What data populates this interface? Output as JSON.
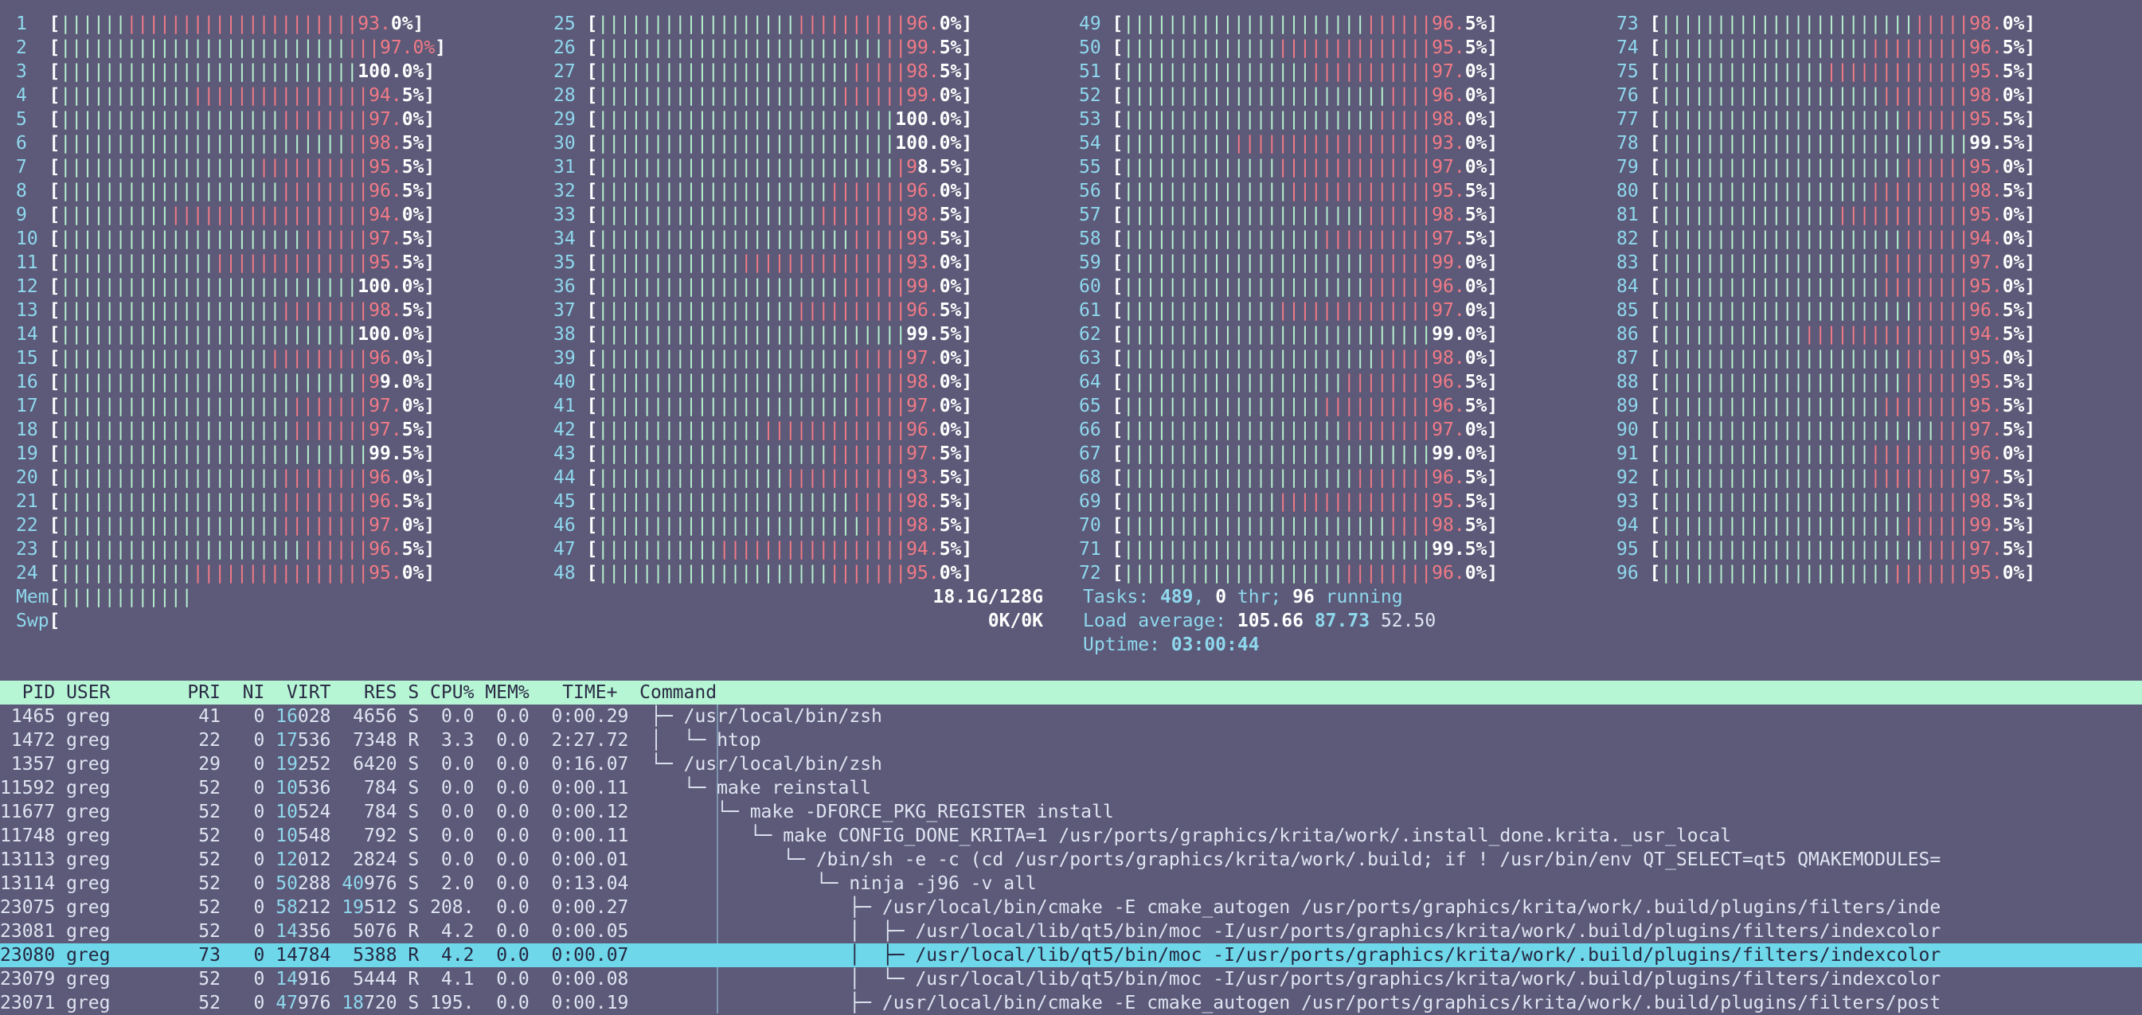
{
  "cpus": [
    {
      "n": "1",
      "pct": "93.",
      "pctw": "0%",
      "g": 6,
      "r": 21
    },
    {
      "n": "2",
      "pct": "97.0%",
      "pctw": "",
      "g": 26,
      "r": 3
    },
    {
      "n": "3",
      "pct": "",
      "pctw": "100.0%",
      "g": 27,
      "r": 0
    },
    {
      "n": "4",
      "pct": "94.",
      "pctw": "5%",
      "g": 12,
      "r": 16
    },
    {
      "n": "5",
      "pct": "97.",
      "pctw": "0%",
      "g": 20,
      "r": 8
    },
    {
      "n": "6",
      "pct": "98.",
      "pctw": "5%",
      "g": 26,
      "r": 2
    },
    {
      "n": "7",
      "pct": "95.",
      "pctw": "5%",
      "g": 18,
      "r": 10
    },
    {
      "n": "8",
      "pct": "96.",
      "pctw": "5%",
      "g": 20,
      "r": 8
    },
    {
      "n": "9",
      "pct": "94.",
      "pctw": "0%",
      "g": 10,
      "r": 18
    },
    {
      "n": "10",
      "pct": "97.",
      "pctw": "5%",
      "g": 22,
      "r": 6
    },
    {
      "n": "11",
      "pct": "95.",
      "pctw": "5%",
      "g": 14,
      "r": 14
    },
    {
      "n": "12",
      "pct": "",
      "pctw": "100.0%",
      "g": 27,
      "r": 0
    },
    {
      "n": "13",
      "pct": "98.",
      "pctw": "5%",
      "g": 20,
      "r": 8
    },
    {
      "n": "14",
      "pct": "",
      "pctw": "100.0%",
      "g": 27,
      "r": 0
    },
    {
      "n": "15",
      "pct": "96.",
      "pctw": "0%",
      "g": 19,
      "r": 9
    },
    {
      "n": "16",
      "pct": "9",
      "pctw": "9.0%",
      "g": 27,
      "r": 1
    },
    {
      "n": "17",
      "pct": "97.",
      "pctw": "0%",
      "g": 21,
      "r": 7
    },
    {
      "n": "18",
      "pct": "97.",
      "pctw": "5%",
      "g": 21,
      "r": 7
    },
    {
      "n": "19",
      "pct": "",
      "pctw": "99.5%",
      "g": 28,
      "r": 0
    },
    {
      "n": "20",
      "pct": "96.",
      "pctw": "0%",
      "g": 20,
      "r": 8
    },
    {
      "n": "21",
      "pct": "96.",
      "pctw": "5%",
      "g": 20,
      "r": 8
    },
    {
      "n": "22",
      "pct": "97.",
      "pctw": "0%",
      "g": 20,
      "r": 8
    },
    {
      "n": "23",
      "pct": "96.",
      "pctw": "5%",
      "g": 22,
      "r": 6
    },
    {
      "n": "24",
      "pct": "95.",
      "pctw": "0%",
      "g": 12,
      "r": 16
    },
    {
      "n": "25",
      "pct": "96.",
      "pctw": "0%",
      "g": 18,
      "r": 10
    },
    {
      "n": "26",
      "pct": "99.",
      "pctw": "5%",
      "g": 26,
      "r": 2
    },
    {
      "n": "27",
      "pct": "98.",
      "pctw": "5%",
      "g": 23,
      "r": 5
    },
    {
      "n": "28",
      "pct": "99.",
      "pctw": "0%",
      "g": 22,
      "r": 6
    },
    {
      "n": "29",
      "pct": "",
      "pctw": "100.0%",
      "g": 27,
      "r": 0
    },
    {
      "n": "30",
      "pct": "",
      "pctw": "100.0%",
      "g": 27,
      "r": 0
    },
    {
      "n": "31",
      "pct": "9",
      "pctw": "8.5%",
      "g": 27,
      "r": 1
    },
    {
      "n": "32",
      "pct": "96.",
      "pctw": "0%",
      "g": 21,
      "r": 7
    },
    {
      "n": "33",
      "pct": "98.",
      "pctw": "5%",
      "g": 20,
      "r": 8
    },
    {
      "n": "34",
      "pct": "99.",
      "pctw": "5%",
      "g": 23,
      "r": 5
    },
    {
      "n": "35",
      "pct": "93.",
      "pctw": "0%",
      "g": 13,
      "r": 15
    },
    {
      "n": "36",
      "pct": "99.",
      "pctw": "0%",
      "g": 22,
      "r": 6
    },
    {
      "n": "37",
      "pct": "96.",
      "pctw": "5%",
      "g": 18,
      "r": 10
    },
    {
      "n": "38",
      "pct": "",
      "pctw": "99.5%",
      "g": 28,
      "r": 0
    },
    {
      "n": "39",
      "pct": "97.",
      "pctw": "0%",
      "g": 23,
      "r": 5
    },
    {
      "n": "40",
      "pct": "98.",
      "pctw": "0%",
      "g": 23,
      "r": 5
    },
    {
      "n": "41",
      "pct": "97.",
      "pctw": "0%",
      "g": 23,
      "r": 5
    },
    {
      "n": "42",
      "pct": "96.",
      "pctw": "0%",
      "g": 15,
      "r": 13
    },
    {
      "n": "43",
      "pct": "97.",
      "pctw": "5%",
      "g": 21,
      "r": 7
    },
    {
      "n": "44",
      "pct": "93.",
      "pctw": "5%",
      "g": 17,
      "r": 11
    },
    {
      "n": "45",
      "pct": "98.",
      "pctw": "5%",
      "g": 23,
      "r": 5
    },
    {
      "n": "46",
      "pct": "98.",
      "pctw": "5%",
      "g": 24,
      "r": 4
    },
    {
      "n": "47",
      "pct": "94.",
      "pctw": "5%",
      "g": 11,
      "r": 17
    },
    {
      "n": "48",
      "pct": "95.",
      "pctw": "0%",
      "g": 21,
      "r": 7
    },
    {
      "n": "49",
      "pct": "96.",
      "pctw": "5%",
      "g": 22,
      "r": 6
    },
    {
      "n": "50",
      "pct": "95.",
      "pctw": "5%",
      "g": 14,
      "r": 14
    },
    {
      "n": "51",
      "pct": "97.",
      "pctw": "0%",
      "g": 17,
      "r": 11
    },
    {
      "n": "52",
      "pct": "96.",
      "pctw": "0%",
      "g": 24,
      "r": 4
    },
    {
      "n": "53",
      "pct": "98.",
      "pctw": "0%",
      "g": 23,
      "r": 5
    },
    {
      "n": "54",
      "pct": "93.",
      "pctw": "0%",
      "g": 10,
      "r": 18
    },
    {
      "n": "55",
      "pct": "97.",
      "pctw": "0%",
      "g": 14,
      "r": 14
    },
    {
      "n": "56",
      "pct": "95.",
      "pctw": "5%",
      "g": 15,
      "r": 13
    },
    {
      "n": "57",
      "pct": "98.",
      "pctw": "5%",
      "g": 22,
      "r": 6
    },
    {
      "n": "58",
      "pct": "97.",
      "pctw": "5%",
      "g": 18,
      "r": 10
    },
    {
      "n": "59",
      "pct": "99.",
      "pctw": "0%",
      "g": 22,
      "r": 6
    },
    {
      "n": "60",
      "pct": "96.",
      "pctw": "0%",
      "g": 22,
      "r": 6
    },
    {
      "n": "61",
      "pct": "97.",
      "pctw": "0%",
      "g": 14,
      "r": 14
    },
    {
      "n": "62",
      "pct": "",
      "pctw": "99.0%",
      "g": 28,
      "r": 0
    },
    {
      "n": "63",
      "pct": "98.",
      "pctw": "0%",
      "g": 23,
      "r": 5
    },
    {
      "n": "64",
      "pct": "96.",
      "pctw": "5%",
      "g": 20,
      "r": 8
    },
    {
      "n": "65",
      "pct": "96.",
      "pctw": "5%",
      "g": 18,
      "r": 10
    },
    {
      "n": "66",
      "pct": "97.",
      "pctw": "0%",
      "g": 20,
      "r": 8
    },
    {
      "n": "67",
      "pct": "",
      "pctw": "99.0%",
      "g": 28,
      "r": 0
    },
    {
      "n": "68",
      "pct": "96.",
      "pctw": "5%",
      "g": 21,
      "r": 7
    },
    {
      "n": "69",
      "pct": "95.",
      "pctw": "5%",
      "g": 14,
      "r": 14
    },
    {
      "n": "70",
      "pct": "98.",
      "pctw": "5%",
      "g": 24,
      "r": 4
    },
    {
      "n": "71",
      "pct": "",
      "pctw": "99.5%",
      "g": 28,
      "r": 0
    },
    {
      "n": "72",
      "pct": "96.",
      "pctw": "0%",
      "g": 20,
      "r": 8
    },
    {
      "n": "73",
      "pct": "98.",
      "pctw": "0%",
      "g": 23,
      "r": 5
    },
    {
      "n": "74",
      "pct": "96.",
      "pctw": "5%",
      "g": 19,
      "r": 9
    },
    {
      "n": "75",
      "pct": "95.",
      "pctw": "5%",
      "g": 15,
      "r": 13
    },
    {
      "n": "76",
      "pct": "98.",
      "pctw": "0%",
      "g": 20,
      "r": 8
    },
    {
      "n": "77",
      "pct": "95.",
      "pctw": "5%",
      "g": 22,
      "r": 6
    },
    {
      "n": "78",
      "pct": "",
      "pctw": "99.5%",
      "g": 28,
      "r": 0
    },
    {
      "n": "79",
      "pct": "95.",
      "pctw": "0%",
      "g": 22,
      "r": 6
    },
    {
      "n": "80",
      "pct": "98.",
      "pctw": "5%",
      "g": 19,
      "r": 9
    },
    {
      "n": "81",
      "pct": "95.",
      "pctw": "0%",
      "g": 16,
      "r": 12
    },
    {
      "n": "82",
      "pct": "94.",
      "pctw": "0%",
      "g": 22,
      "r": 6
    },
    {
      "n": "83",
      "pct": "97.",
      "pctw": "0%",
      "g": 20,
      "r": 8
    },
    {
      "n": "84",
      "pct": "95.",
      "pctw": "0%",
      "g": 20,
      "r": 8
    },
    {
      "n": "85",
      "pct": "96.",
      "pctw": "5%",
      "g": 23,
      "r": 5
    },
    {
      "n": "86",
      "pct": "94.",
      "pctw": "5%",
      "g": 13,
      "r": 15
    },
    {
      "n": "87",
      "pct": "95.",
      "pctw": "0%",
      "g": 22,
      "r": 6
    },
    {
      "n": "88",
      "pct": "95.",
      "pctw": "5%",
      "g": 22,
      "r": 6
    },
    {
      "n": "89",
      "pct": "95.",
      "pctw": "5%",
      "g": 20,
      "r": 8
    },
    {
      "n": "90",
      "pct": "97.",
      "pctw": "5%",
      "g": 25,
      "r": 3
    },
    {
      "n": "91",
      "pct": "96.",
      "pctw": "0%",
      "g": 19,
      "r": 9
    },
    {
      "n": "92",
      "pct": "97.",
      "pctw": "5%",
      "g": 19,
      "r": 9
    },
    {
      "n": "93",
      "pct": "98.",
      "pctw": "5%",
      "g": 23,
      "r": 5
    },
    {
      "n": "94",
      "pct": "99.",
      "pctw": "5%",
      "g": 22,
      "r": 6
    },
    {
      "n": "95",
      "pct": "97.",
      "pctw": "5%",
      "g": 24,
      "r": 4
    },
    {
      "n": "96",
      "pct": "95.",
      "pctw": "0%",
      "g": 21,
      "r": 7
    }
  ],
  "mem": {
    "label": "Mem",
    "bars": "||||||||||||",
    "value": "18.1G/128G"
  },
  "swp": {
    "label": "Swp",
    "value": "0K/0K"
  },
  "tasks": {
    "label": "Tasks: ",
    "count": "489",
    "sep": ", ",
    "thr": "0",
    "thr_label": " thr; ",
    "running": "96",
    "running_label": " running"
  },
  "load": {
    "label": "Load average: ",
    "v1": "105.66",
    "v2": "87.73",
    "v3": "52.50"
  },
  "uptime": {
    "label": "Uptime: ",
    "value": "03:00:44"
  },
  "header": "  PID USER       PRI  NI  VIRT   RES S CPU% MEM%   TIME+  Command",
  "processes": [
    {
      "pid": " 1465",
      "user": "greg",
      "pri": "41",
      "ni": "0",
      "virt_hl": "16",
      "virt": "028",
      "res_hl": "",
      "res": "4656",
      "s": "S",
      "cpu": "0.0",
      "mem": "0.0",
      "time": "0:00.29",
      "tree": "├─ ",
      "cmd": "/usr/local/bin/zsh"
    },
    {
      "pid": " 1472",
      "user": "greg",
      "pri": "22",
      "ni": "0",
      "virt_hl": "17",
      "virt": "536",
      "res_hl": "",
      "res": "7348",
      "s": "R",
      "cpu": "3.3",
      "mem": "0.0",
      "time": "2:27.72",
      "tree": "│  └─ ",
      "cmd": "htop"
    },
    {
      "pid": " 1357",
      "user": "greg",
      "pri": "29",
      "ni": "0",
      "virt_hl": "19",
      "virt": "252",
      "res_hl": "",
      "res": "6420",
      "s": "S",
      "cpu": "0.0",
      "mem": "0.0",
      "time": "0:16.07",
      "tree": "└─ ",
      "cmd": "/usr/local/bin/zsh"
    },
    {
      "pid": "11592",
      "user": "greg",
      "pri": "52",
      "ni": "0",
      "virt_hl": "10",
      "virt": "536",
      "res_hl": "",
      "res": "784",
      "s": "S",
      "cpu": "0.0",
      "mem": "0.0",
      "time": "0:00.11",
      "tree": "   └─ ",
      "cmd": "make reinstall"
    },
    {
      "pid": "11677",
      "user": "greg",
      "pri": "52",
      "ni": "0",
      "virt_hl": "10",
      "virt": "524",
      "res_hl": "",
      "res": "784",
      "s": "S",
      "cpu": "0.0",
      "mem": "0.0",
      "time": "0:00.12",
      "tree": "      └─ ",
      "cmd": "make -DFORCE_PKG_REGISTER install"
    },
    {
      "pid": "11748",
      "user": "greg",
      "pri": "52",
      "ni": "0",
      "virt_hl": "10",
      "virt": "548",
      "res_hl": "",
      "res": "792",
      "s": "S",
      "cpu": "0.0",
      "mem": "0.0",
      "time": "0:00.11",
      "tree": "         └─ ",
      "cmd": "make CONFIG_DONE_KRITA=1 /usr/ports/graphics/krita/work/.install_done.krita._usr_local"
    },
    {
      "pid": "13113",
      "user": "greg",
      "pri": "52",
      "ni": "0",
      "virt_hl": "12",
      "virt": "012",
      "res_hl": "",
      "res": "2824",
      "s": "S",
      "cpu": "0.0",
      "mem": "0.0",
      "time": "0:00.01",
      "tree": "            └─ ",
      "cmd": "/bin/sh -e -c (cd /usr/ports/graphics/krita/work/.build; if ! /usr/bin/env QT_SELECT=qt5 QMAKEMODULES="
    },
    {
      "pid": "13114",
      "user": "greg",
      "pri": "52",
      "ni": "0",
      "virt_hl": "50",
      "virt": "288",
      "res_hl": "40",
      "res": "976",
      "s": "S",
      "cpu": "2.0",
      "mem": "0.0",
      "time": "0:13.04",
      "tree": "               └─ ",
      "cmd": "ninja -j96 -v all"
    },
    {
      "pid": "23075",
      "user": "greg",
      "pri": "52",
      "ni": "0",
      "virt_hl": "58",
      "virt": "212",
      "res_hl": "19",
      "res": "512",
      "s": "S",
      "cpu": "208.",
      "mem": "0.0",
      "time": "0:00.27",
      "tree": "                  ├─ ",
      "cmd": "/usr/local/bin/cmake -E cmake_autogen /usr/ports/graphics/krita/work/.build/plugins/filters/inde"
    },
    {
      "pid": "23081",
      "user": "greg",
      "pri": "52",
      "ni": "0",
      "virt_hl": "14",
      "virt": "356",
      "res_hl": "",
      "res": "5076",
      "s": "R",
      "cpu": "4.2",
      "mem": "0.0",
      "time": "0:00.05",
      "tree": "                  │  ├─ ",
      "cmd": "/usr/local/lib/qt5/bin/moc -I/usr/ports/graphics/krita/work/.build/plugins/filters/indexcolor"
    },
    {
      "pid": "23080",
      "user": "greg",
      "pri": "73",
      "ni": "0",
      "virt_hl": "",
      "virt": "14784",
      "res_hl": "",
      "res": "5388",
      "s": "R",
      "cpu": "4.2",
      "mem": "0.0",
      "time": "0:00.07",
      "tree": "                  │  ├─ ",
      "cmd": "/usr/local/lib/qt5/bin/moc -I/usr/ports/graphics/krita/work/.build/plugins/filters/indexcolor",
      "selected": true
    },
    {
      "pid": "23079",
      "user": "greg",
      "pri": "52",
      "ni": "0",
      "virt_hl": "14",
      "virt": "916",
      "res_hl": "",
      "res": "5444",
      "s": "R",
      "cpu": "4.1",
      "mem": "0.0",
      "time": "0:00.08",
      "tree": "                  │  └─ ",
      "cmd": "/usr/local/lib/qt5/bin/moc -I/usr/ports/graphics/krita/work/.build/plugins/filters/indexcolor"
    },
    {
      "pid": "23071",
      "user": "greg",
      "pri": "52",
      "ni": "0",
      "virt_hl": "47",
      "virt": "976",
      "res_hl": "18",
      "res": "720",
      "s": "S",
      "cpu": "195.",
      "mem": "0.0",
      "time": "0:00.19",
      "tree": "                  ├─ ",
      "cmd": "/usr/local/bin/cmake -E cmake_autogen /usr/ports/graphics/krita/work/.build/plugins/filters/post"
    }
  ]
}
